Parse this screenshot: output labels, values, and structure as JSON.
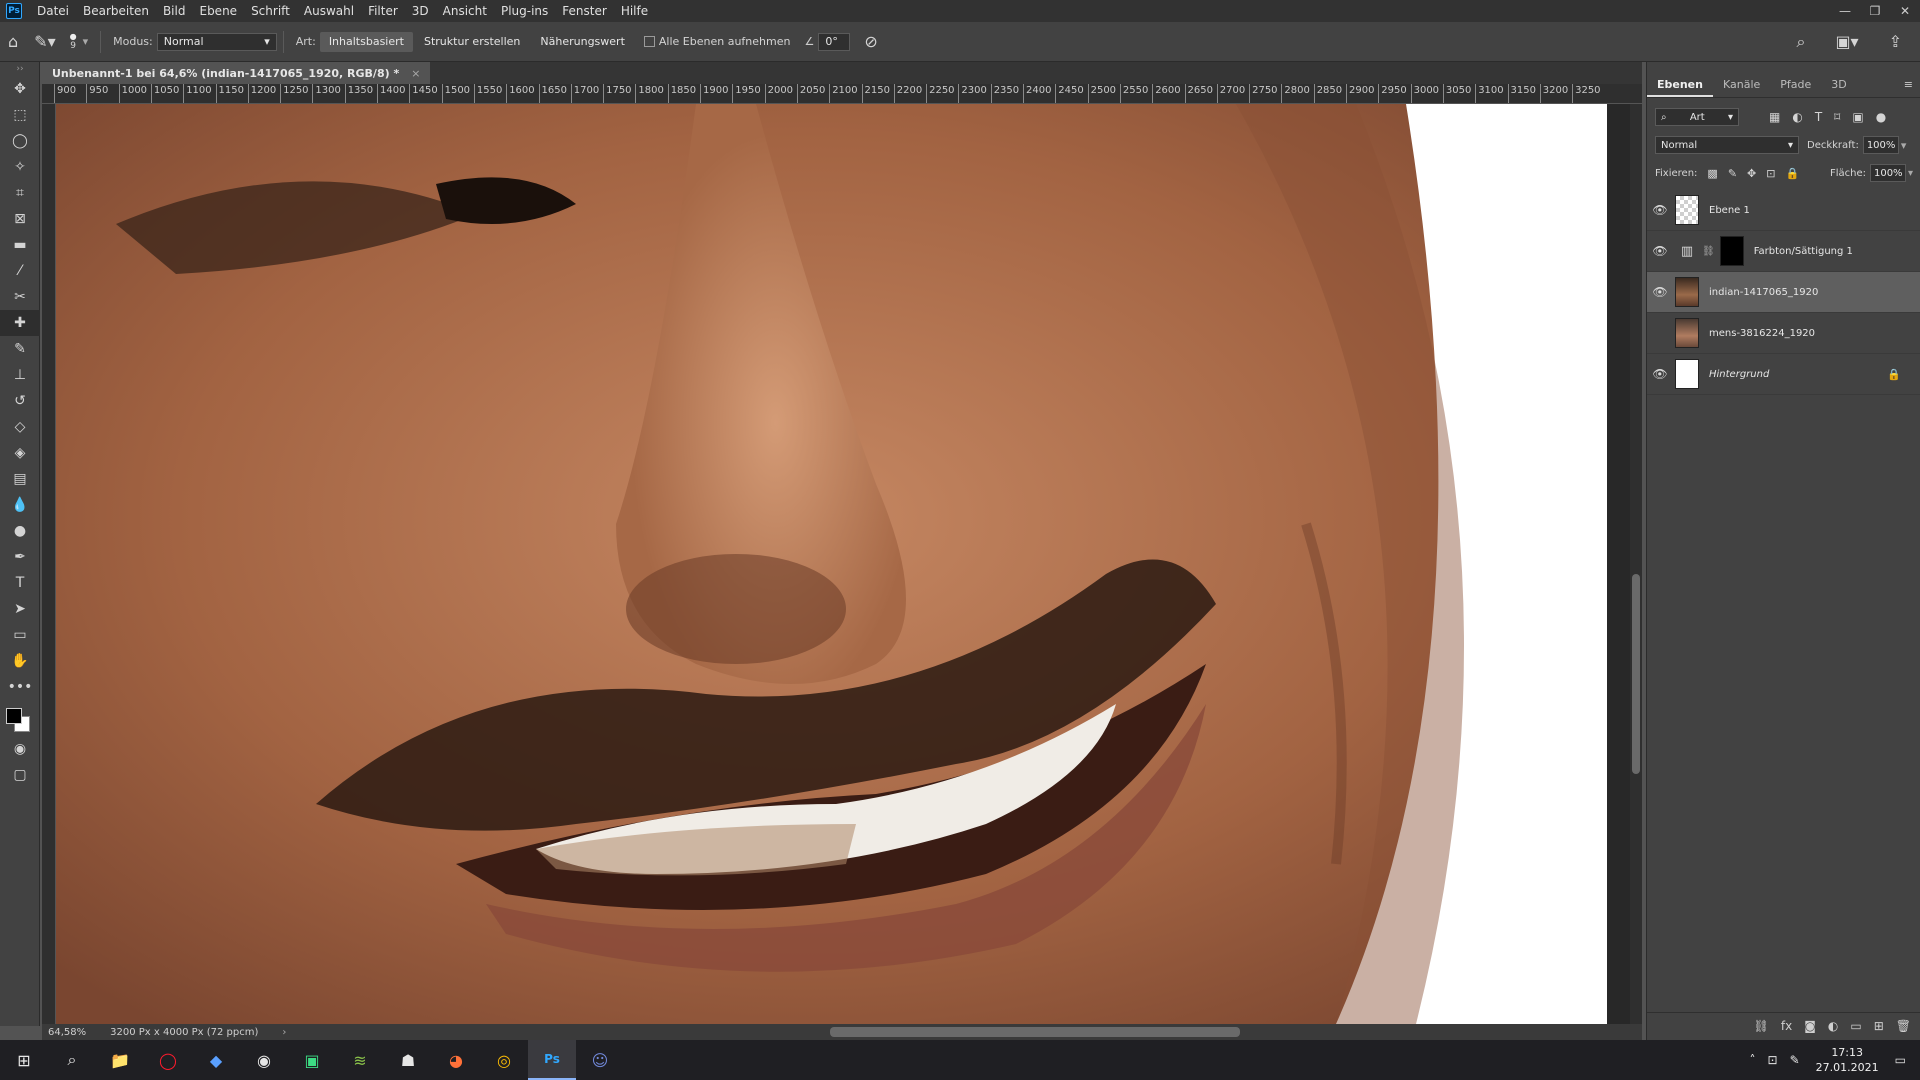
{
  "menu": {
    "app_logo": "Ps",
    "items": [
      "Datei",
      "Bearbeiten",
      "Bild",
      "Ebene",
      "Schrift",
      "Auswahl",
      "Filter",
      "3D",
      "Ansicht",
      "Plug-ins",
      "Fenster",
      "Hilfe"
    ]
  },
  "options": {
    "brush_size": "9",
    "mode_label": "Modus:",
    "mode_value": "Normal",
    "type_label": "Art:",
    "type_buttons": [
      "Inhaltsbasiert",
      "Struktur erstellen",
      "Näherungswert"
    ],
    "sample_all_label": "Alle Ebenen aufnehmen",
    "angle_value": "0°"
  },
  "document": {
    "tab_title": "Unbenannt-1 bei 64,6% (indian-1417065_1920, RGB/8) *",
    "tab_close": "×"
  },
  "ruler": {
    "ticks": [
      "900",
      "950",
      "1000",
      "1050",
      "1100",
      "1150",
      "1200",
      "1250",
      "1300",
      "1350",
      "1400",
      "1450",
      "1500",
      "1550",
      "1600",
      "1650",
      "1700",
      "1750",
      "1800",
      "1850",
      "1900",
      "1950",
      "2000",
      "2050",
      "2100",
      "2150",
      "2200",
      "2250",
      "2300",
      "2350",
      "2400",
      "2450",
      "2500",
      "2550",
      "2600",
      "2650",
      "2700",
      "2750",
      "2800",
      "2850",
      "2900",
      "2950",
      "3000",
      "3050",
      "3100",
      "3150",
      "3200",
      "3250"
    ]
  },
  "status": {
    "zoom": "64,58%",
    "doc_size": "3200 Px x 4000 Px (72 ppcm)"
  },
  "panel": {
    "tabs": [
      "Ebenen",
      "Kanäle",
      "Pfade",
      "3D"
    ],
    "filter_value": "Art",
    "blend_mode": "Normal",
    "opacity_label": "Deckkraft:",
    "opacity_value": "100%",
    "lock_label": "Fixieren:",
    "fill_label": "Fläche:",
    "fill_value": "100%"
  },
  "layers": [
    {
      "name": "Ebene 1",
      "visible": true,
      "thumb": "checker"
    },
    {
      "name": "Farbton/Sättigung 1",
      "visible": true,
      "thumb": "adjustment"
    },
    {
      "name": "indian-1417065_1920",
      "visible": true,
      "thumb": "face1",
      "selected": true
    },
    {
      "name": "mens-3816224_1920",
      "visible": false,
      "thumb": "face2"
    },
    {
      "name": "Hintergrund",
      "visible": true,
      "thumb": "white",
      "locked": true
    }
  ],
  "taskbar": {
    "time": "17:13",
    "date": "27.01.2021"
  },
  "colors": {
    "accent": "#31a8ff",
    "skin": "#a86a48"
  }
}
